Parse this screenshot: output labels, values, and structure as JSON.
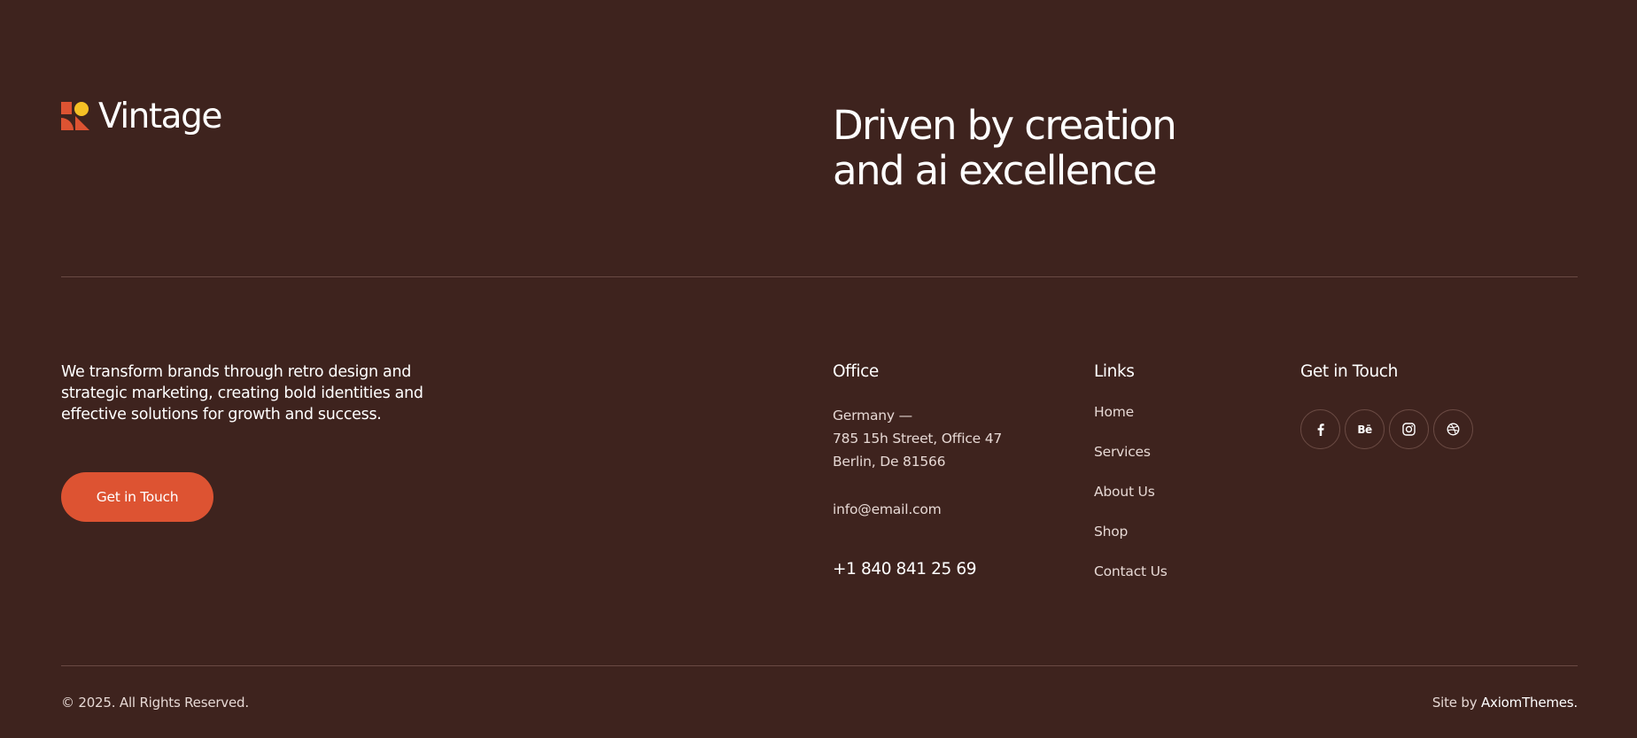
{
  "brand": {
    "name": "Vintage",
    "logo_icon": "vintage-logo-mark",
    "colors": {
      "background": "#3e231e",
      "accent": "#dd5332",
      "logo_yellow": "#f5c025"
    }
  },
  "hero": {
    "tagline_line1": "Driven by creation",
    "tagline_line2": "and ai excellence"
  },
  "about": {
    "description": "We transform brands through retro design and strategic marketing, creating bold identities and effective solutions for growth and success.",
    "cta_label": "Get in Touch"
  },
  "office": {
    "heading": "Office",
    "address_line1": "Germany —",
    "address_line2": "785 15h Street, Office 47",
    "address_line3": "Berlin, De 81566",
    "email": "info@email.com",
    "phone": "+1 840 841 25 69"
  },
  "links": {
    "heading": "Links",
    "items": [
      {
        "label": "Home"
      },
      {
        "label": "Services"
      },
      {
        "label": "About Us"
      },
      {
        "label": "Shop"
      },
      {
        "label": "Contact Us"
      }
    ]
  },
  "get_in_touch": {
    "heading": "Get in Touch",
    "socials": [
      {
        "icon": "facebook-icon"
      },
      {
        "icon": "behance-icon",
        "text": "Bē"
      },
      {
        "icon": "instagram-icon"
      },
      {
        "icon": "dribbble-icon"
      }
    ]
  },
  "bottom": {
    "copyright": "© 2025. All Rights Reserved.",
    "credit_prefix": "Site by",
    "credit_link": "AxiomThemes."
  }
}
